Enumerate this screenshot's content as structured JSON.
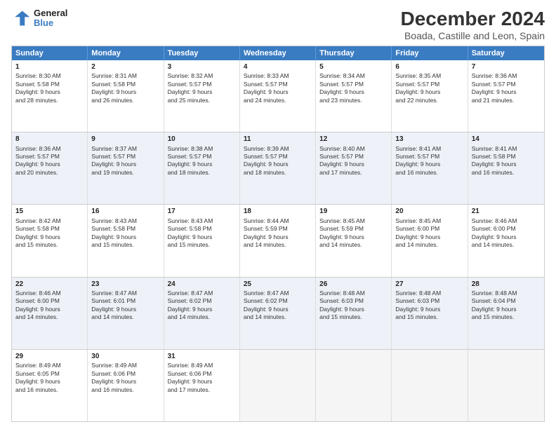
{
  "logo": {
    "line1": "General",
    "line2": "Blue"
  },
  "title": "December 2024",
  "subtitle": "Boada, Castille and Leon, Spain",
  "header_days": [
    "Sunday",
    "Monday",
    "Tuesday",
    "Wednesday",
    "Thursday",
    "Friday",
    "Saturday"
  ],
  "weeks": [
    [
      {
        "day": "1",
        "lines": [
          "Sunrise: 8:30 AM",
          "Sunset: 5:58 PM",
          "Daylight: 9 hours",
          "and 28 minutes."
        ]
      },
      {
        "day": "2",
        "lines": [
          "Sunrise: 8:31 AM",
          "Sunset: 5:58 PM",
          "Daylight: 9 hours",
          "and 26 minutes."
        ]
      },
      {
        "day": "3",
        "lines": [
          "Sunrise: 8:32 AM",
          "Sunset: 5:57 PM",
          "Daylight: 9 hours",
          "and 25 minutes."
        ]
      },
      {
        "day": "4",
        "lines": [
          "Sunrise: 8:33 AM",
          "Sunset: 5:57 PM",
          "Daylight: 9 hours",
          "and 24 minutes."
        ]
      },
      {
        "day": "5",
        "lines": [
          "Sunrise: 8:34 AM",
          "Sunset: 5:57 PM",
          "Daylight: 9 hours",
          "and 23 minutes."
        ]
      },
      {
        "day": "6",
        "lines": [
          "Sunrise: 8:35 AM",
          "Sunset: 5:57 PM",
          "Daylight: 9 hours",
          "and 22 minutes."
        ]
      },
      {
        "day": "7",
        "lines": [
          "Sunrise: 8:36 AM",
          "Sunset: 5:57 PM",
          "Daylight: 9 hours",
          "and 21 minutes."
        ]
      }
    ],
    [
      {
        "day": "8",
        "lines": [
          "Sunrise: 8:36 AM",
          "Sunset: 5:57 PM",
          "Daylight: 9 hours",
          "and 20 minutes."
        ]
      },
      {
        "day": "9",
        "lines": [
          "Sunrise: 8:37 AM",
          "Sunset: 5:57 PM",
          "Daylight: 9 hours",
          "and 19 minutes."
        ]
      },
      {
        "day": "10",
        "lines": [
          "Sunrise: 8:38 AM",
          "Sunset: 5:57 PM",
          "Daylight: 9 hours",
          "and 18 minutes."
        ]
      },
      {
        "day": "11",
        "lines": [
          "Sunrise: 8:39 AM",
          "Sunset: 5:57 PM",
          "Daylight: 9 hours",
          "and 18 minutes."
        ]
      },
      {
        "day": "12",
        "lines": [
          "Sunrise: 8:40 AM",
          "Sunset: 5:57 PM",
          "Daylight: 9 hours",
          "and 17 minutes."
        ]
      },
      {
        "day": "13",
        "lines": [
          "Sunrise: 8:41 AM",
          "Sunset: 5:57 PM",
          "Daylight: 9 hours",
          "and 16 minutes."
        ]
      },
      {
        "day": "14",
        "lines": [
          "Sunrise: 8:41 AM",
          "Sunset: 5:58 PM",
          "Daylight: 9 hours",
          "and 16 minutes."
        ]
      }
    ],
    [
      {
        "day": "15",
        "lines": [
          "Sunrise: 8:42 AM",
          "Sunset: 5:58 PM",
          "Daylight: 9 hours",
          "and 15 minutes."
        ]
      },
      {
        "day": "16",
        "lines": [
          "Sunrise: 8:43 AM",
          "Sunset: 5:58 PM",
          "Daylight: 9 hours",
          "and 15 minutes."
        ]
      },
      {
        "day": "17",
        "lines": [
          "Sunrise: 8:43 AM",
          "Sunset: 5:58 PM",
          "Daylight: 9 hours",
          "and 15 minutes."
        ]
      },
      {
        "day": "18",
        "lines": [
          "Sunrise: 8:44 AM",
          "Sunset: 5:59 PM",
          "Daylight: 9 hours",
          "and 14 minutes."
        ]
      },
      {
        "day": "19",
        "lines": [
          "Sunrise: 8:45 AM",
          "Sunset: 5:59 PM",
          "Daylight: 9 hours",
          "and 14 minutes."
        ]
      },
      {
        "day": "20",
        "lines": [
          "Sunrise: 8:45 AM",
          "Sunset: 6:00 PM",
          "Daylight: 9 hours",
          "and 14 minutes."
        ]
      },
      {
        "day": "21",
        "lines": [
          "Sunrise: 8:46 AM",
          "Sunset: 6:00 PM",
          "Daylight: 9 hours",
          "and 14 minutes."
        ]
      }
    ],
    [
      {
        "day": "22",
        "lines": [
          "Sunrise: 8:46 AM",
          "Sunset: 6:00 PM",
          "Daylight: 9 hours",
          "and 14 minutes."
        ]
      },
      {
        "day": "23",
        "lines": [
          "Sunrise: 8:47 AM",
          "Sunset: 6:01 PM",
          "Daylight: 9 hours",
          "and 14 minutes."
        ]
      },
      {
        "day": "24",
        "lines": [
          "Sunrise: 8:47 AM",
          "Sunset: 6:02 PM",
          "Daylight: 9 hours",
          "and 14 minutes."
        ]
      },
      {
        "day": "25",
        "lines": [
          "Sunrise: 8:47 AM",
          "Sunset: 6:02 PM",
          "Daylight: 9 hours",
          "and 14 minutes."
        ]
      },
      {
        "day": "26",
        "lines": [
          "Sunrise: 8:48 AM",
          "Sunset: 6:03 PM",
          "Daylight: 9 hours",
          "and 15 minutes."
        ]
      },
      {
        "day": "27",
        "lines": [
          "Sunrise: 8:48 AM",
          "Sunset: 6:03 PM",
          "Daylight: 9 hours",
          "and 15 minutes."
        ]
      },
      {
        "day": "28",
        "lines": [
          "Sunrise: 8:48 AM",
          "Sunset: 6:04 PM",
          "Daylight: 9 hours",
          "and 15 minutes."
        ]
      }
    ],
    [
      {
        "day": "29",
        "lines": [
          "Sunrise: 8:49 AM",
          "Sunset: 6:05 PM",
          "Daylight: 9 hours",
          "and 16 minutes."
        ]
      },
      {
        "day": "30",
        "lines": [
          "Sunrise: 8:49 AM",
          "Sunset: 6:06 PM",
          "Daylight: 9 hours",
          "and 16 minutes."
        ]
      },
      {
        "day": "31",
        "lines": [
          "Sunrise: 8:49 AM",
          "Sunset: 6:06 PM",
          "Daylight: 9 hours",
          "and 17 minutes."
        ]
      },
      {
        "day": "",
        "lines": []
      },
      {
        "day": "",
        "lines": []
      },
      {
        "day": "",
        "lines": []
      },
      {
        "day": "",
        "lines": []
      }
    ]
  ]
}
